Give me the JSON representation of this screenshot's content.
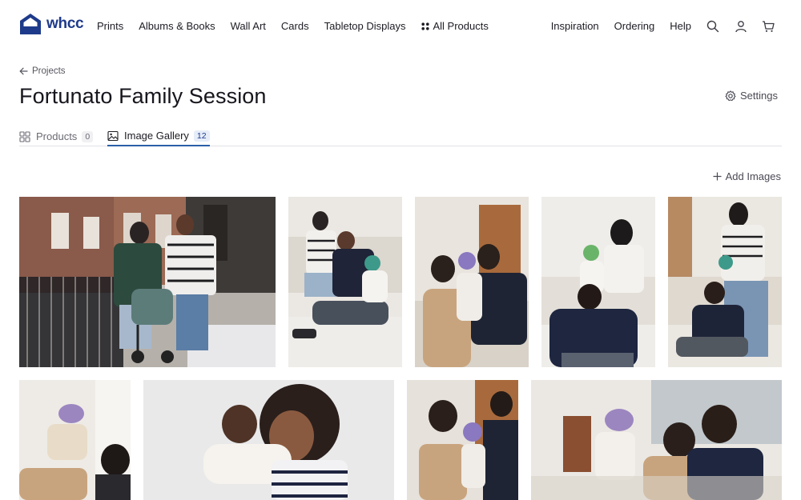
{
  "brand": {
    "name": "whcc",
    "color": "#1e3a8a"
  },
  "nav": {
    "left": [
      "Prints",
      "Albums & Books",
      "Wall Art",
      "Cards",
      "Tabletop Displays"
    ],
    "all_products": "All Products",
    "right": [
      "Inspiration",
      "Ordering",
      "Help"
    ]
  },
  "header_icons": [
    "search-icon",
    "user-icon",
    "cart-icon"
  ],
  "breadcrumb": {
    "label": "Projects"
  },
  "page": {
    "title": "Fortunato Family Session",
    "settings_label": "Settings"
  },
  "tabs": [
    {
      "label": "Products",
      "count": "0",
      "icon": "grid-icon",
      "active": false
    },
    {
      "label": "Image Gallery",
      "count": "12",
      "icon": "image-icon",
      "active": true
    }
  ],
  "actions": {
    "add_images": "Add Images"
  },
  "colors": {
    "accent": "#2b5fa8",
    "text": "#1c1c24",
    "muted": "#6a6a74"
  },
  "gallery": {
    "images": [
      {
        "scene": "family walking with stroller on city street"
      },
      {
        "scene": "family sitting on floor with baby"
      },
      {
        "scene": "mother and father holding baby on couch"
      },
      {
        "scene": "father carrying baby on shoulders"
      },
      {
        "scene": "family playing on rug by couch"
      },
      {
        "scene": "father lifting baby in the air"
      },
      {
        "scene": "mother holding baby close"
      },
      {
        "scene": "parents smiling with baby"
      },
      {
        "scene": "family sitting together with baby"
      }
    ]
  }
}
